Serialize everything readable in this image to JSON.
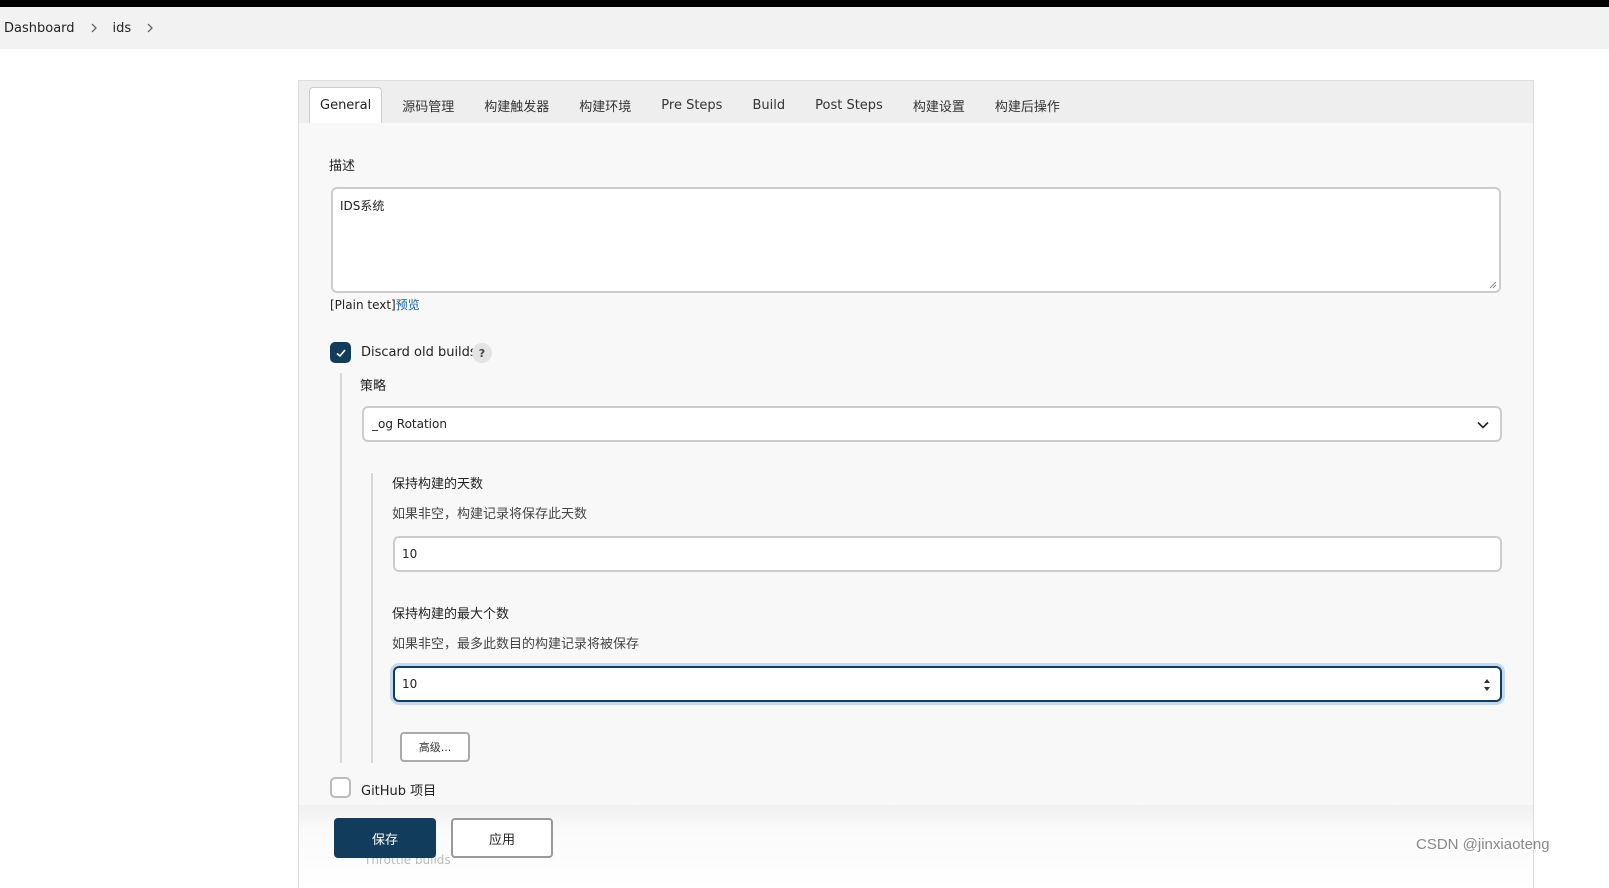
{
  "breadcrumb": [
    "Dashboard",
    "ids"
  ],
  "tabs": [
    {
      "label": "General",
      "active": true
    },
    {
      "label": "源码管理"
    },
    {
      "label": "构建触发器"
    },
    {
      "label": "构建环境"
    },
    {
      "label": "Pre Steps"
    },
    {
      "label": "Build"
    },
    {
      "label": "Post Steps"
    },
    {
      "label": "构建设置"
    },
    {
      "label": "构建后操作"
    }
  ],
  "description": {
    "label": "描述",
    "value": "IDS系统",
    "format": "[Plain text]",
    "preview_link": "预览"
  },
  "discard_old_builds": {
    "label": "Discard old builds",
    "checked": true,
    "help": "?",
    "strategy_label": "策略",
    "strategy_value": "_og Rotation",
    "days_label": "保持构建的天数",
    "days_hint": "如果非空，构建记录将保存此天数",
    "days_value": "10",
    "max_label": "保持构建的最大个数",
    "max_hint": "如果非空，最多此数目的构建记录将被保存",
    "max_value": "10",
    "advanced_button": "高级..."
  },
  "github_project": {
    "label": "GitHub 项目",
    "checked": false
  },
  "hidden_next": "Throttle builds",
  "buttons": {
    "save": "保存",
    "apply": "应用"
  },
  "watermark": "CSDN @jinxiaoteng",
  "colors": {
    "primary": "#123c5c",
    "link": "#1a5ba8"
  }
}
